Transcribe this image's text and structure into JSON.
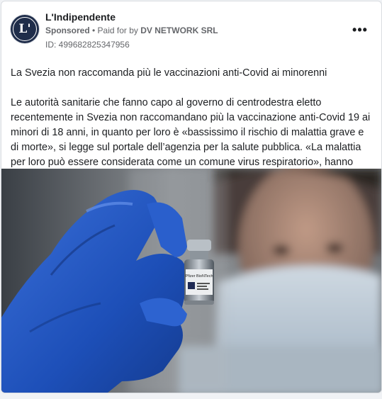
{
  "post": {
    "page_name": "L'Indipendente",
    "logo_letter": "L'",
    "sponsored_label": "Sponsored",
    "paid_for_prefix": " • Paid for by ",
    "paid_for_name": "DV NETWORK SRL",
    "ad_id": "ID: 499682825347956",
    "more_icon": "•••",
    "headline": "La Svezia non raccomanda più le vaccinazioni anti-Covid ai minorenni",
    "body": "Le autorità sanitarie che fanno capo al governo di centrodestra eletto recentemente in Svezia non raccomandano più la vaccinazione anti-Covid 19 ai minori di 18 anni, in quanto per loro è «bassissimo il rischio di malattia grave e di morte», si legge sul portale dell’agenzia per la salute pubblica. «La malattia per loro può essere considerata come un comune virus respiratorio», hanno spiegato…",
    "vial_label": "Pfizer BioNTech"
  },
  "colors": {
    "logo_bg": "#1f2d4a",
    "glove": "#1d4fb8",
    "secondary_text": "#65676b"
  },
  "icons": {
    "more": "more-options-icon",
    "logo": "publisher-logo"
  }
}
